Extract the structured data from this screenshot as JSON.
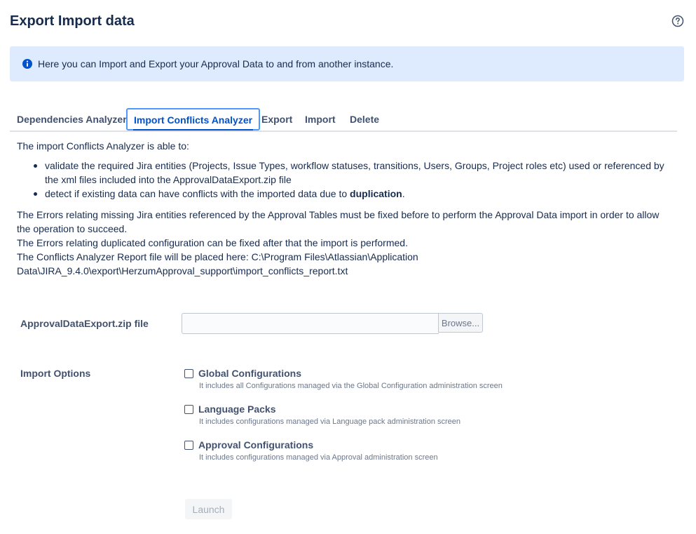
{
  "page": {
    "title": "Export Import data",
    "help_icon": "question-circle-icon"
  },
  "banner": {
    "icon": "info-icon",
    "text": "Here you can Import and Export your Approval Data to and from another instance.",
    "background": "#deebff"
  },
  "tabs": [
    {
      "label": "Dependencies Analyzer",
      "active": false
    },
    {
      "label": "Import Conflicts Analyzer",
      "active": true
    },
    {
      "label": "Export",
      "active": false
    },
    {
      "label": "Import",
      "active": false
    },
    {
      "label": "Delete",
      "active": false
    }
  ],
  "content": {
    "intro": "The import Conflicts Analyzer is able to:",
    "bullets": [
      "validate the required Jira entities (Projects, Issue Types, workflow statuses, transitions, Users, Groups, Project roles etc) used or referenced by the xml files included into the ApprovalDataExport.zip file",
      {
        "prefix": "detect if existing data can have conflicts with the imported data due to ",
        "bold": "duplication",
        "suffix": "."
      }
    ],
    "para1": "The Errors relating missing Jira entities referenced by the Approval Tables must be fixed before to perform the Approval Data import in order to allow the operation to succeed.",
    "para2": "The Errors relating duplicated configuration can be fixed after that the import is performed.",
    "para3": "The Conflicts Analyzer Report file will be placed here: C:\\Program Files\\Atlassian\\Application Data\\JIRA_9.4.0\\export\\HerzumApproval_support\\import_conflicts_report.txt"
  },
  "form": {
    "file_label": "ApprovalDataExport.zip file",
    "file_value": "",
    "browse_label": "Browse...",
    "options_label": "Import Options",
    "options": [
      {
        "label": "Global Configurations",
        "description": "It includes all Configurations managed via the Global Configuration administration screen",
        "checked": false
      },
      {
        "label": "Language Packs",
        "description": "It includes configurations managed via Language pack administration screen",
        "checked": false
      },
      {
        "label": "Approval Configurations",
        "description": "It includes configurations managed via Approval administration screen",
        "checked": false
      }
    ],
    "launch_label": "Launch"
  },
  "colors": {
    "text": "#172b4d",
    "label": "#42526e",
    "accent": "#0052cc",
    "muted": "#6b778c"
  }
}
